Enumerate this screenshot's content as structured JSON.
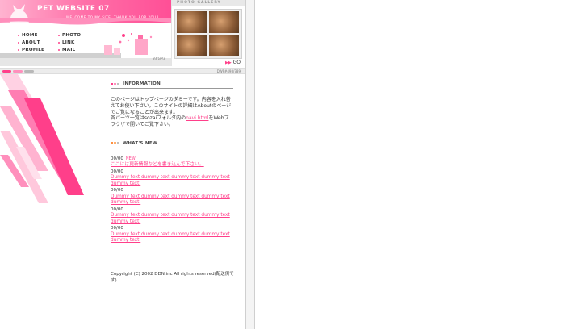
{
  "site": {
    "title": "PET WEBSITE 07",
    "welcome": "WELCOME TO MY SITE. THANK YOU FOR YOUR ACCESS.",
    "header_code": "013050"
  },
  "nav": [
    {
      "label": "HOME"
    },
    {
      "label": "PHOTO"
    },
    {
      "label": "ABOUT"
    },
    {
      "label": "LINK"
    },
    {
      "label": "PROFILE"
    },
    {
      "label": "MAIL"
    }
  ],
  "gallery": {
    "title": "PHOTO GALLERY",
    "go_label": "GO"
  },
  "thin_bar": {
    "code": "DWF#498/789"
  },
  "information": {
    "title": "INFORMATION",
    "text_1": "このページはトップページのダミーです。内容を入れ替えてお使い下さい。このサイトの詳細はAboutのページでご覧になることが出来ます。",
    "text_2": "各パーツ一覧はsozaiフォルダ内の",
    "link": "navi.html",
    "text_3": "をWebブラウザで開いてご覧下さい。"
  },
  "whats_new": {
    "title": "WHAT'S NEW",
    "items": [
      {
        "date": "00/00",
        "badge": "NEW",
        "text": "ここには更新情報などを書き込んで下さい。"
      },
      {
        "date": "00/00",
        "text": "Dummy text dummy text dummy text dummy text dummy text."
      },
      {
        "date": "00/00",
        "text": "Dummy text dummy text dummy text dummy text dummy text."
      },
      {
        "date": "00/00",
        "text": "Dummy text dummy text dummy text dummy text dummy text."
      },
      {
        "date": "00/00",
        "text": "Dummy text dummy text dummy text dummy text dummy text."
      }
    ]
  },
  "footer": {
    "copyright": "Copyright (C) 2002 DDN,inc All rights reserved(配送例です)"
  },
  "colors": {
    "accent": "#ff3f8a",
    "pink_light": "#ffb3d0",
    "pink_mid": "#ff6fa8"
  }
}
